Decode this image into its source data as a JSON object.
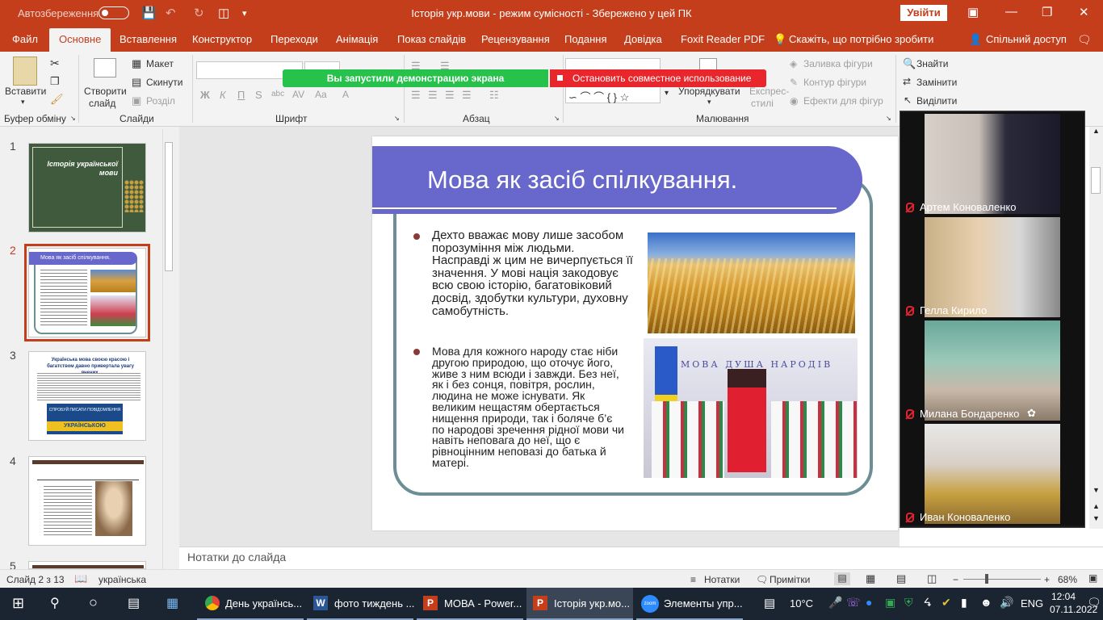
{
  "titlebar": {
    "autosave_label": "Автозбереження",
    "title": "Історія укр.мови  -  режим сумісності  -  Збережено у цей ПК",
    "signin": "Увійти"
  },
  "tabs": [
    {
      "label": "Файл"
    },
    {
      "label": "Основне"
    },
    {
      "label": "Вставлення"
    },
    {
      "label": "Конструктор"
    },
    {
      "label": "Переходи"
    },
    {
      "label": "Анімація"
    },
    {
      "label": "Показ слайдів"
    },
    {
      "label": "Рецензування"
    },
    {
      "label": "Подання"
    },
    {
      "label": "Довідка"
    },
    {
      "label": "Foxit Reader PDF"
    },
    {
      "label": "Скажіть, що потрібно зробити"
    },
    {
      "label": "Спільний доступ"
    }
  ],
  "ribbon": {
    "paste": "Вставити",
    "create_slide": "Створити",
    "create_slide2": "слайд",
    "layout": "Макет",
    "reset": "Скинути",
    "section": "Розділ",
    "bold": "Ж",
    "italic": "К",
    "underline": "П",
    "strike": "S",
    "arrange": "Упорядкувати",
    "quick_styles": "Експрес-",
    "quick_styles2": "стилі",
    "shape_fill": "Заливка фігури",
    "shape_outline": "Контур фігури",
    "shape_effects": "Ефекти для фігур",
    "find": "Знайти",
    "replace": "Замінити",
    "select": "Виділити",
    "groups": {
      "clipboard": "Буфер обміну",
      "slides": "Слайди",
      "font": "Шрифт",
      "paragraph": "Абзац",
      "drawing": "Малювання"
    },
    "share_banner": "Вы запустили демонстрацию экрана",
    "stop_share": "Остановить совместное использование"
  },
  "thumbnails": [
    {
      "num": "1",
      "title": "Історія української мови"
    },
    {
      "num": "2",
      "title": "Мова як засіб спілкування."
    },
    {
      "num": "3",
      "title": "Українська мова своєю красою і багатством давно привертала увагу вчених.",
      "badge1": "СПРОБУЙ ПИСАТИ ПОВІДОМЛЕННЯ",
      "badge2": "УКРАЇНСЬКОЮ"
    },
    {
      "num": "4"
    },
    {
      "num": "5"
    }
  ],
  "slide": {
    "title": "Мова як засіб спілкування.",
    "para1": "Дехто вважає мову лише засобом порозуміння між людьми. Насправді ж цим не вичерпується її значення. У мові нація закодовує  всю свою історію, багатовіковий досвід, здобутки культури, духовну самобутність.",
    "para2": "Мова для кожного народу стає ніби другою природою, що оточує його, живе з ним всюди і завжди. Без неї, як і без сонця, повітря, рослин, людина не може існувати. Як великим нещастям обертається нищення природи, так і боляче б’є по народові зречення рідної мови чи навіть неповага до неї, що є рівноцінним неповазі до батька й матері.",
    "banner_text": "МОВА   ДУША   НАРОДІВ"
  },
  "notes_placeholder": "Нотатки до слайда",
  "status": {
    "slide": "Слайд 2 з 13",
    "language": "українська",
    "notes": "Нотатки",
    "comments": "Примітки",
    "zoom": "68%"
  },
  "zoom_participants": [
    {
      "name": "Артем Коноваленко"
    },
    {
      "name": "Гелла Кирило"
    },
    {
      "name": "Милана Бондаренко"
    },
    {
      "name": "Иван Коноваленко"
    }
  ],
  "taskbar": {
    "apps": [
      {
        "label": "День українсь..."
      },
      {
        "label": "фото тиждень ..."
      },
      {
        "label": "МОВА - Power..."
      },
      {
        "label": "Історія укр.мо..."
      },
      {
        "label": "Элементы упр..."
      }
    ],
    "weather": "10°C",
    "lang": "ENG",
    "time": "12:04",
    "date": "07.11.2022"
  }
}
